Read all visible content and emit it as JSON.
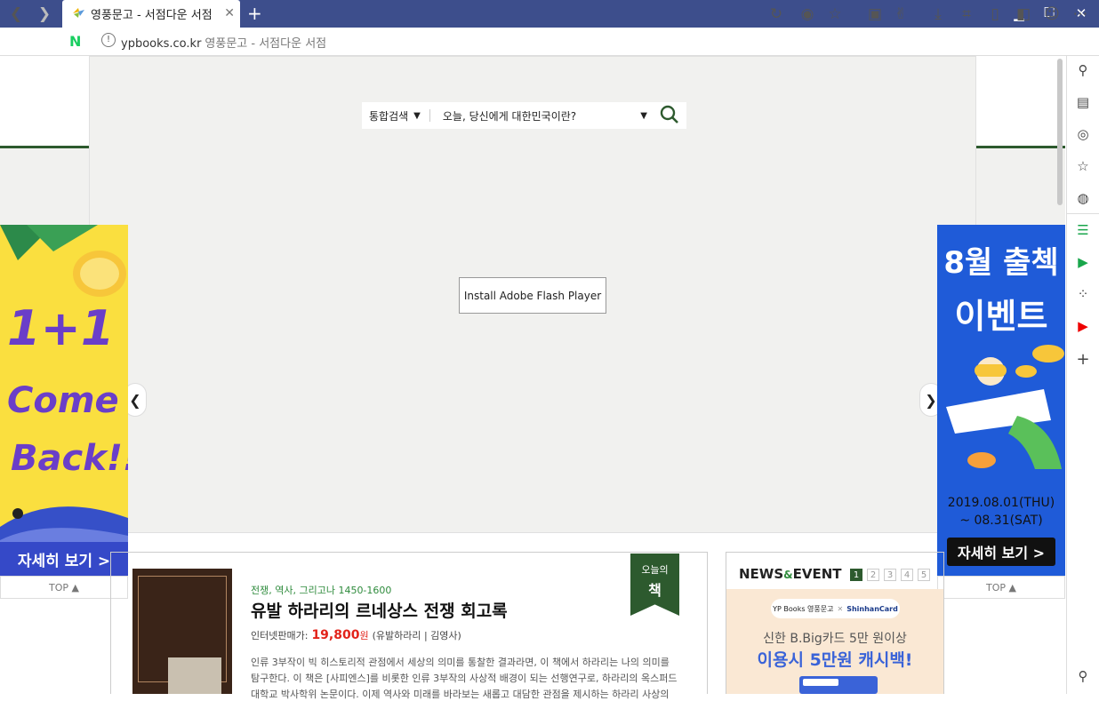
{
  "browser": {
    "tab_title": "영풍문고 - 서점다운 서점",
    "url_domain": "ypbooks.co.kr",
    "url_title": "영풍문고 - 서점다운 서점"
  },
  "search": {
    "category": "통합검색",
    "query": "오늘, 당신에게 대한민국이란?"
  },
  "hero": {
    "flash_button": "Install Adobe Flash Player"
  },
  "ad_left": {
    "line1": "1+1",
    "line2": "Come",
    "line3": "Back!!",
    "cta": "자세히 보기 >",
    "top": "TOP ▲"
  },
  "ad_right": {
    "line1": "8월 출첵",
    "line2": "이벤트",
    "date1": "2019.08.01(THU)",
    "date2": "~ 08.31(SAT)",
    "cta": "자세히 보기 >",
    "top": "TOP ▲"
  },
  "book": {
    "badge_top": "오늘의",
    "badge_bottom": "책",
    "category": "전쟁, 역사, 그리고나 1450-1600",
    "title": "유발 하라리의 르네상스 전쟁 회고록",
    "price_label": "인터넷판매가:",
    "price": "19,800",
    "price_unit": "원",
    "author": "(유발하라리 | 김영사)",
    "desc1": "인류 3부작이 빅 히스토리적 관점에서 세상의 의미를 통찰한 결과라면, 이 책에서 하라리는 나의 의미를",
    "desc2": "탐구한다. 이 책은 [사피엔스]를 비롯한 인류 3부작의 사상적 배경이 되는 선행연구로, 하라리의 옥스퍼드",
    "desc3": "대학교 박사학위 논문이다. 이제 역사와 미래를 바라보는 새롭고 대담한 관점을 제시하는 하라리 사상의"
  },
  "news": {
    "title_news": "NEWS",
    "title_amp": "&",
    "title_event": "EVENT",
    "pages": [
      "1",
      "2",
      "3",
      "4",
      "5"
    ],
    "logo_yp": "YP Books 영풍문고",
    "logo_x": "✕",
    "logo_shinhan": "ShinhanCard",
    "line1": "신한 B.Big카드 5만 원이상",
    "line2": "이용시 5만원 캐시백!"
  },
  "colors": {
    "titlebar": "#3d4e8c",
    "brand_green": "#2d5a2e",
    "price_red": "#e2231a"
  }
}
